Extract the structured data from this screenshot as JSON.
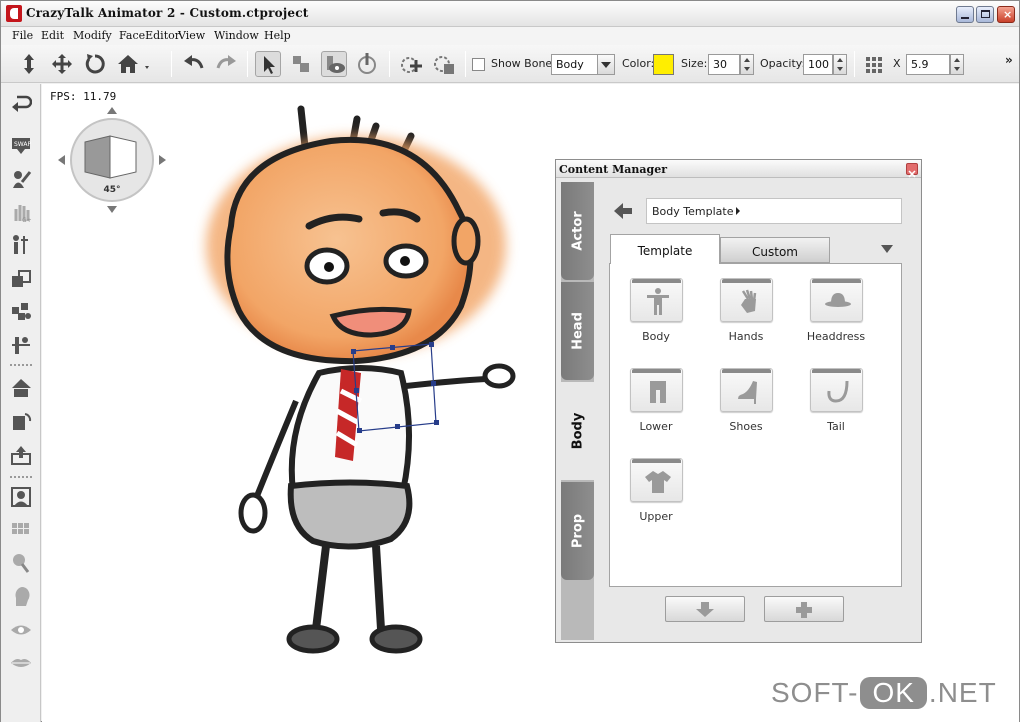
{
  "window": {
    "title": "CrazyTalk Animator 2   - Custom.ctproject"
  },
  "menu": [
    "File",
    "Edit",
    "Modify",
    "FaceEditor",
    "View",
    "Window",
    "Help"
  ],
  "toolbar": {
    "show_bone_label": "Show Bone",
    "bone_mode": "Body",
    "color_label": "Color:",
    "color_value": "#ffee00",
    "size_label": "Size:",
    "size_value": "30",
    "opacity_label": "Opacity:",
    "opacity_value": "100",
    "x_label": "X",
    "x_value": "5.9",
    "overflow": "»"
  },
  "viewport": {
    "fps": "FPS: 11.79",
    "camera_angle": "45°"
  },
  "content_manager": {
    "title": "Content Manager",
    "side_tabs": [
      "Actor",
      "Head",
      "Body",
      "Prop"
    ],
    "active_side_tab": "Body",
    "breadcrumb": "Body Template",
    "tabs": [
      "Template",
      "Custom"
    ],
    "active_tab": "Template",
    "items": [
      {
        "label": "Body",
        "icon": "body-icon"
      },
      {
        "label": "Hands",
        "icon": "hands-icon"
      },
      {
        "label": "Headdress",
        "icon": "headdress-icon"
      },
      {
        "label": "Lower",
        "icon": "lower-icon"
      },
      {
        "label": "Shoes",
        "icon": "shoes-icon"
      },
      {
        "label": "Tail",
        "icon": "tail-icon"
      },
      {
        "label": "Upper",
        "icon": "upper-icon"
      }
    ]
  },
  "watermark": {
    "left": "SOFT-",
    "mid": "OK",
    "right": ".NET"
  }
}
